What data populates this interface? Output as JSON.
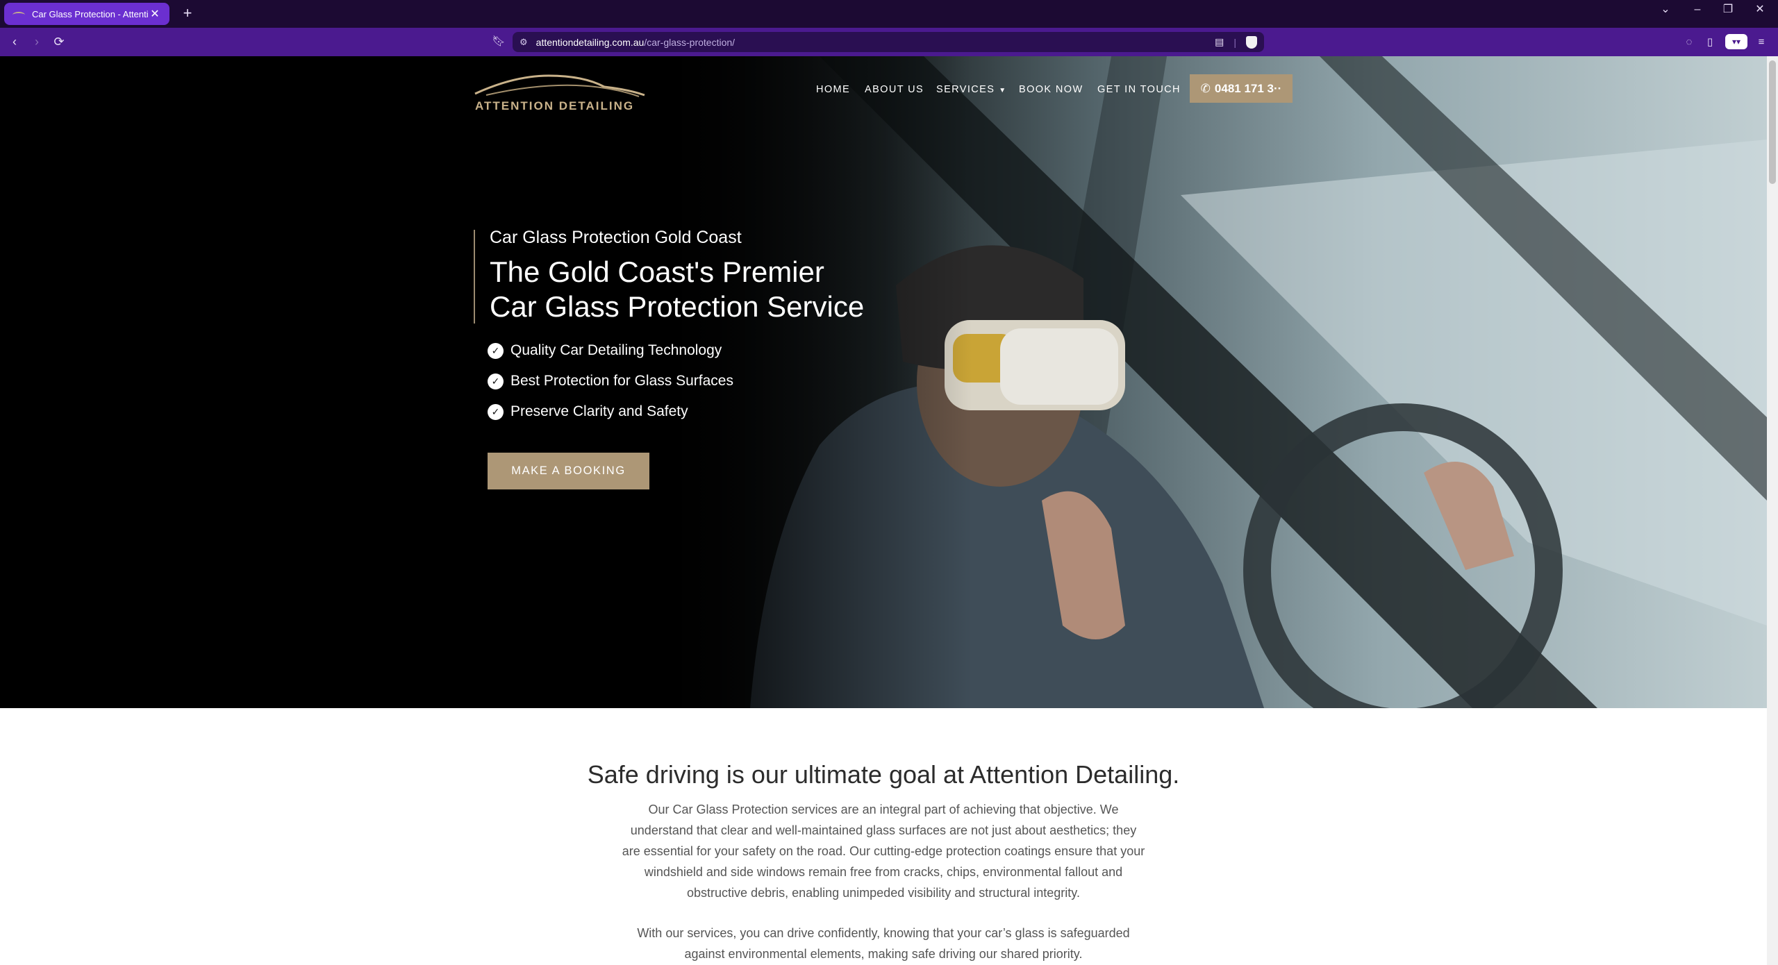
{
  "browser": {
    "tab_title": "Car Glass Protection - Attention",
    "new_tab_label": "+",
    "url_host": "attentiondetailing.com.au",
    "url_path": "/car-glass-protection/"
  },
  "site": {
    "logo_text": "ATTENTION DETAILING",
    "nav": {
      "home": "HOME",
      "about": "ABOUT US",
      "services": "SERVICES",
      "book": "BOOK NOW",
      "contact": "GET IN TOUCH"
    },
    "phone_button": "0481 171 3··"
  },
  "hero": {
    "subtitle": "Car Glass Protection Gold Coast",
    "title_line1": "The Gold Coast's Premier",
    "title_line2": "Car Glass Protection Service",
    "features": [
      "Quality Car Detailing Technology",
      "Best Protection for Glass Surfaces",
      "Preserve Clarity and Safety"
    ],
    "cta": "MAKE A BOOKING"
  },
  "content": {
    "heading": "Safe driving is our ultimate goal at Attention Detailing.",
    "paragraph1_lines": [
      "Our Car Glass Protection services are an integral part of achieving that objective. We",
      "understand that clear and well-maintained glass surfaces are not just about aesthetics; they",
      "are essential for your safety on the road. Our cutting-edge protection coatings ensure that your",
      "windshield and side windows remain free from cracks, chips, environmental fallout and",
      "obstructive debris, enabling unimpeded visibility and structural integrity."
    ],
    "paragraph2_lines": [
      "With our services, you can drive confidently, knowing that your car’s glass is safeguarded",
      "against environmental elements, making safe driving our shared priority."
    ]
  },
  "colors": {
    "accent": "#ad9776",
    "tabbar": "#1c0a33",
    "toolbar": "#4b1a8f",
    "active_tab": "#6b2fd0"
  }
}
